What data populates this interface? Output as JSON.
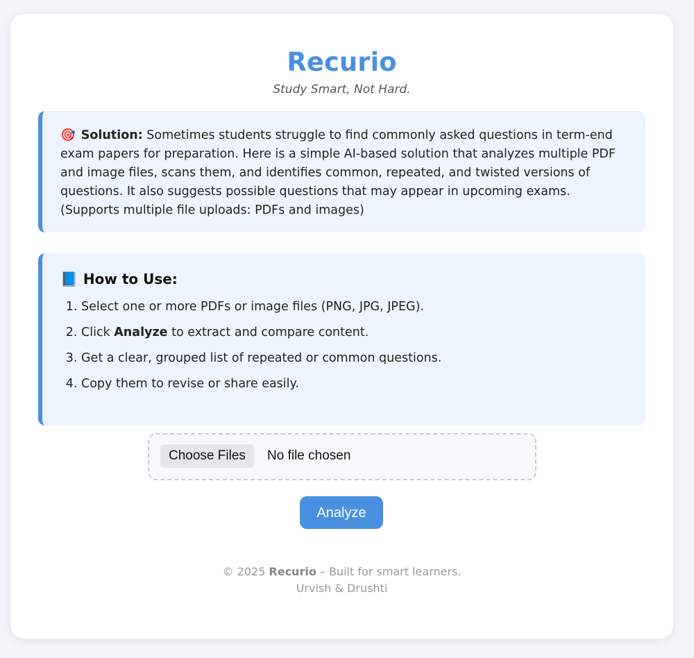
{
  "header": {
    "title": "Recurio",
    "tagline": "Study Smart, Not Hard."
  },
  "solution": {
    "icon": "target-icon",
    "icon_glyph": "🎯",
    "label": "Solution:",
    "text": " Sometimes students struggle to find commonly asked questions in term-end exam papers for preparation. Here is a simple AI-based solution that analyzes multiple PDF and image files, scans them, and identifies common, repeated, and twisted versions of questions. It also suggests possible questions that may appear in upcoming exams. (Supports multiple file uploads: PDFs and images)"
  },
  "how_to": {
    "icon": "book-icon",
    "icon_glyph": "📘",
    "title": "How to Use:",
    "steps": {
      "step1": "Select one or more PDFs or image files (PNG, JPG, JPEG).",
      "step2_prefix": "Click ",
      "step2_bold": "Analyze",
      "step2_suffix": " to extract and compare content.",
      "step3": "Get a clear, grouped list of repeated or common questions.",
      "step4": "Copy them to revise or share easily."
    }
  },
  "upload": {
    "button_label": "Choose Files",
    "status": "No file chosen"
  },
  "analyze_button": "Analyze",
  "footer": {
    "copyright_prefix": "© 2025 ",
    "brand": "Recurio",
    "copyright_suffix": " – Built for smart learners.",
    "authors": "Urvish & Drushti"
  },
  "colors": {
    "accent": "#4a90e2",
    "info_box_bg": "#edf4fd"
  }
}
